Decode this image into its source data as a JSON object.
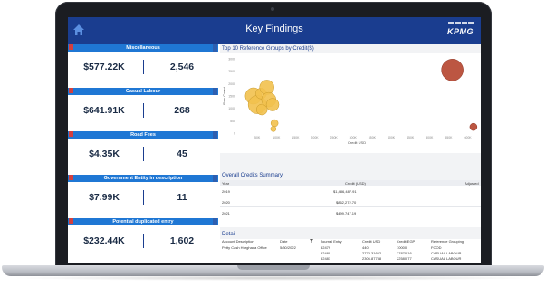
{
  "header": {
    "title": "Key Findings",
    "logo": "KPMG"
  },
  "cards": [
    {
      "label": "Miscellaneous",
      "amount": "$577.22K",
      "count": "2,546"
    },
    {
      "label": "Casual Labour",
      "amount": "$641.91K",
      "count": "268"
    },
    {
      "label": "Road Fees",
      "amount": "$4.35K",
      "count": "45"
    },
    {
      "label": "Government Entity in description",
      "amount": "$7.99K",
      "count": "11"
    },
    {
      "label": "Potential duplicated entry",
      "amount": "$232.44K",
      "count": "1,602"
    }
  ],
  "chart_panel": {
    "title": "Top 10 Reference Groups by Credit($)"
  },
  "chart_data": {
    "type": "scatter",
    "title": "Top 10 Reference Groups by Credit($)",
    "xlabel": "Credit USD",
    "ylabel": "Row Count",
    "x_ticks": [
      "50K",
      "100K",
      "150K",
      "200K",
      "250K",
      "300K",
      "350K",
      "400K",
      "450K",
      "500K",
      "550K",
      "600K"
    ],
    "y_ticks": [
      "3000",
      "2500",
      "2000",
      "1500",
      "1000",
      "500",
      "0"
    ],
    "xlim": [
      0,
      620000
    ],
    "ylim": [
      0,
      3000
    ],
    "points": [
      {
        "x": 40000,
        "y": 1500,
        "size": 9,
        "color": "#f2c14e"
      },
      {
        "x": 50000,
        "y": 1150,
        "size": 10,
        "color": "#f2c14e"
      },
      {
        "x": 60000,
        "y": 1600,
        "size": 6,
        "color": "#f2c14e"
      },
      {
        "x": 62000,
        "y": 950,
        "size": 6,
        "color": "#f2c14e"
      },
      {
        "x": 75000,
        "y": 1850,
        "size": 8,
        "color": "#f2c14e"
      },
      {
        "x": 80000,
        "y": 1350,
        "size": 8,
        "color": "#f2c14e"
      },
      {
        "x": 90000,
        "y": 1150,
        "size": 7,
        "color": "#f2c14e"
      },
      {
        "x": 95000,
        "y": 400,
        "size": 4,
        "color": "#f2c14e"
      },
      {
        "x": 92000,
        "y": 170,
        "size": 3,
        "color": "#f2c14e"
      },
      {
        "x": 560000,
        "y": 2550,
        "size": 12,
        "color": "#b5442e"
      },
      {
        "x": 615000,
        "y": 250,
        "size": 4,
        "color": "#b5442e"
      }
    ]
  },
  "summary": {
    "title": "Overall Credits Summary",
    "columns": [
      "Year",
      "Credit (USD)",
      "Adjusted"
    ],
    "rows": [
      {
        "year": "2019",
        "credit": "$1,486,487.91"
      },
      {
        "year": "2020",
        "credit": "$862,272.70"
      },
      {
        "year": "2021",
        "credit": "$499,747.19"
      }
    ]
  },
  "detail": {
    "title": "Detail",
    "columns": [
      "Account Description",
      "Date",
      "Journal Entry",
      "Credit USD",
      "Credit EGP",
      "Reference Grouping"
    ],
    "rows": [
      {
        "desc": "Petty Cash Hurghada Office",
        "date": "5/30/2022",
        "entry": "52479",
        "usd": "440",
        "egp": "10000",
        "group": "FOOD"
      },
      {
        "desc": "",
        "date": "",
        "entry": "52480",
        "usd": "2773.31652",
        "egp": "27870.16",
        "group": "CASUAL LABOUR"
      },
      {
        "desc": "",
        "date": "",
        "entry": "52481",
        "usd": "2306.87738",
        "egp": "22580.77",
        "group": "CASUAL LABOUR"
      }
    ]
  }
}
